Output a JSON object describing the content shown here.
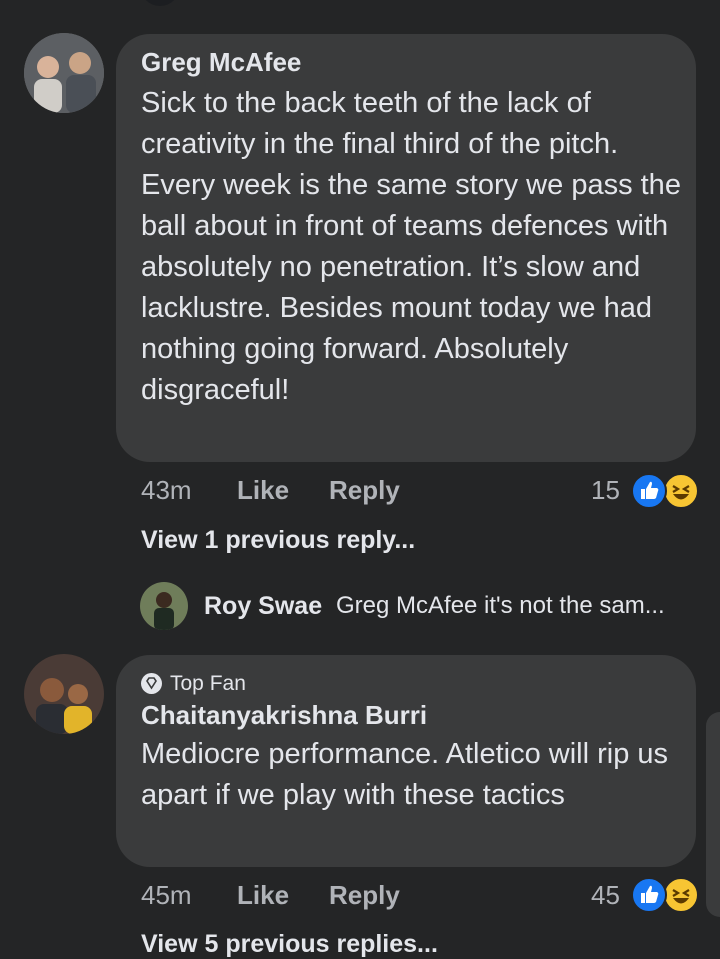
{
  "comments": [
    {
      "author": "Greg McAfee",
      "text": "Sick to the back teeth of the lack of creativity in the final third of the pitch. Every week is the same story we pass the ball about in front of teams defences with absolutely no penetration. It’s slow and lacklustre. Besides mount today we had nothing going forward. Absolutely disgraceful!",
      "time": "43m",
      "like_label": "Like",
      "reply_label": "Reply",
      "reaction_count": "15",
      "reactions": [
        "like-icon",
        "haha-icon"
      ],
      "view_replies": "View 1 previous reply...",
      "reply_preview": {
        "author": "Roy Swae",
        "text": "Greg McAfee it's not the sam..."
      }
    },
    {
      "badge": "Top Fan",
      "badge_icon": "diamond-icon",
      "author": "Chaitanyakrishna Burri",
      "text": "Mediocre performance. Atletico will rip us apart if we play with these tactics",
      "time": "45m",
      "like_label": "Like",
      "reply_label": "Reply",
      "reaction_count": "45",
      "reactions": [
        "like-icon",
        "haha-icon"
      ],
      "view_replies": "View 5 previous replies..."
    }
  ],
  "colors": {
    "background": "#242526",
    "bubble": "#3a3b3c",
    "text": "#e4e6eb",
    "secondary": "#b0b3b8",
    "like_blue": "#1877f2",
    "haha_yellow": "#f7c533"
  }
}
